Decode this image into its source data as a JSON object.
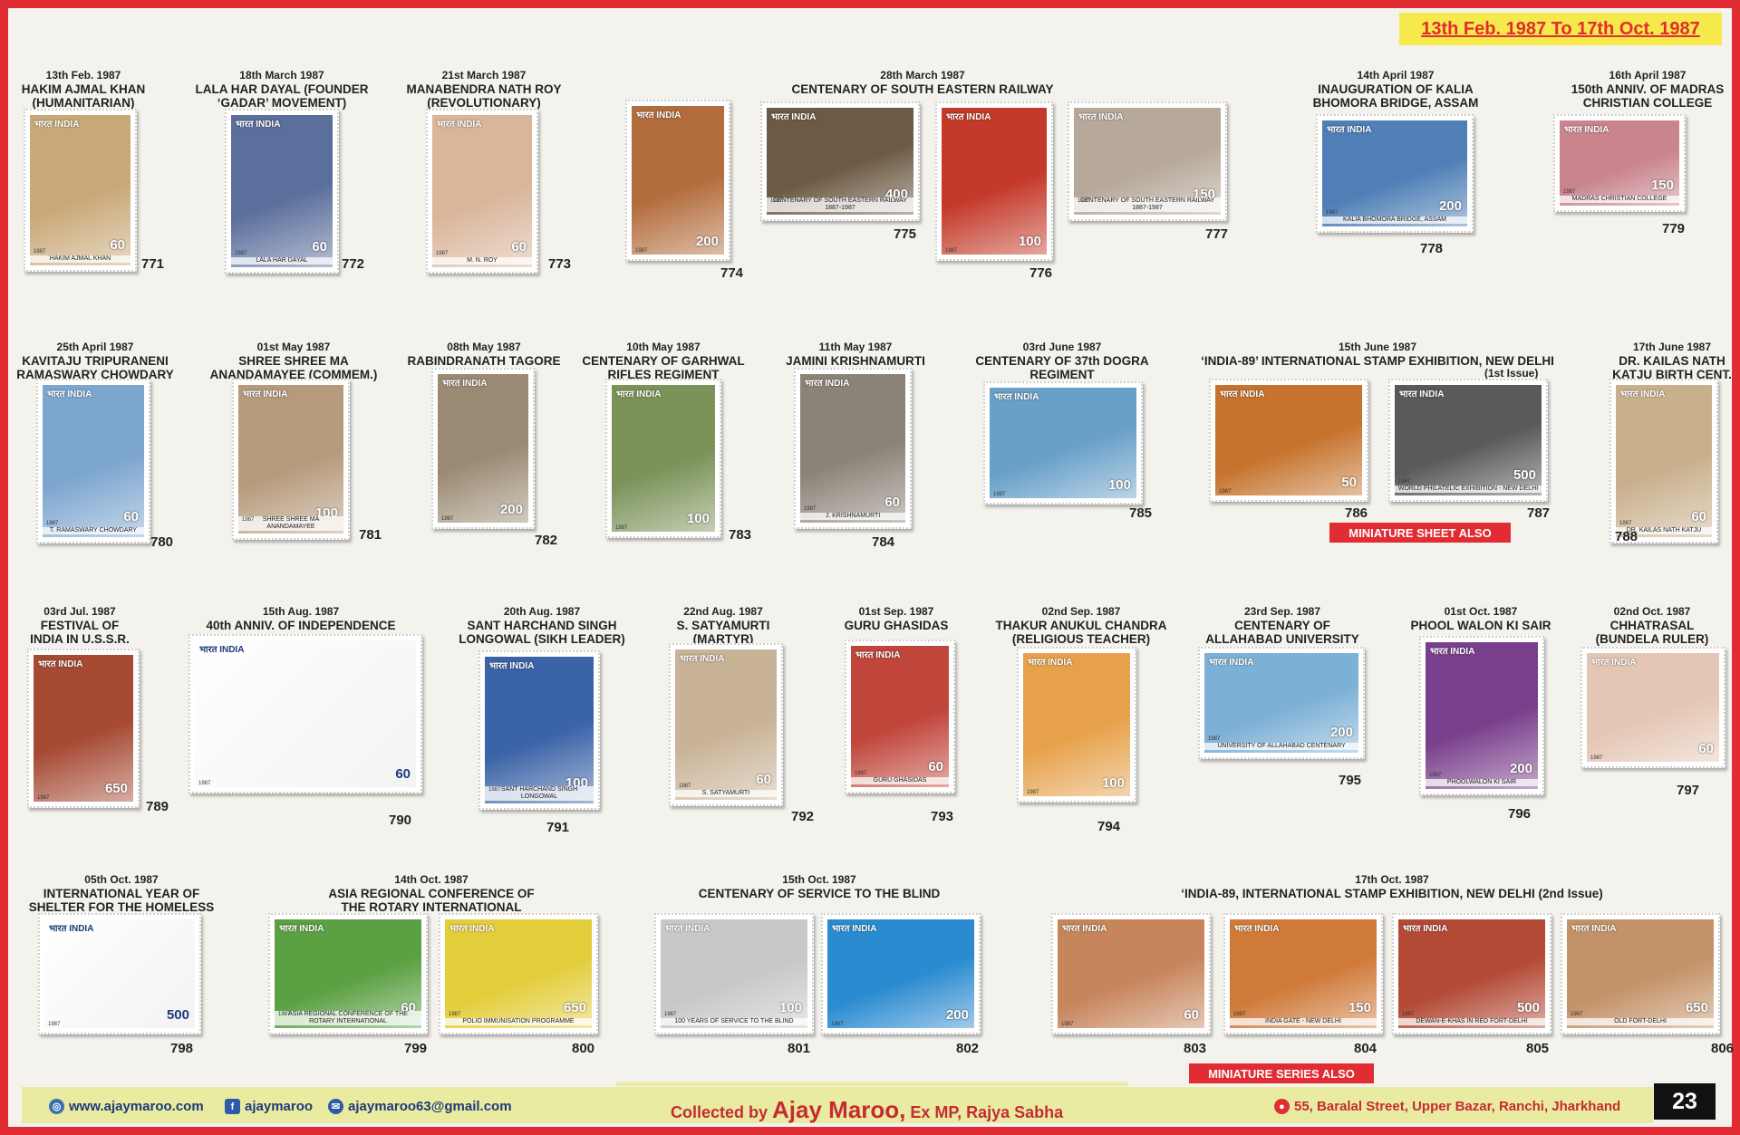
{
  "date_range": "13th Feb. 1987 To 17th Oct. 1987",
  "groups": [
    {
      "date": "13th Feb. 1987",
      "title": [
        "HAKIM AJMAL KHAN",
        "(HUMANITARIAN)"
      ]
    },
    {
      "date": "18th March 1987",
      "title": [
        "LALA HAR DAYAL (FOUNDER",
        "‘GADAR’ MOVEMENT)"
      ]
    },
    {
      "date": "21st March 1987",
      "title": [
        "MANABENDRA NATH ROY",
        "(REVOLUTIONARY)"
      ]
    },
    {
      "date": "28th March 1987",
      "title": [
        "CENTENARY OF SOUTH EASTERN RAILWAY"
      ]
    },
    {
      "date": "14th April 1987",
      "title": [
        "INAUGURATION OF KALIA",
        "BHOMORA BRIDGE, ASSAM"
      ]
    },
    {
      "date": "16th April 1987",
      "title": [
        "150th ANNIV. OF MADRAS",
        "CHRISTIAN COLLEGE"
      ]
    },
    {
      "date": "25th April 1987",
      "title": [
        "KAVITAJU TRIPURANENI",
        "RAMASWARY CHOWDARY"
      ]
    },
    {
      "date": "01st May 1987",
      "title": [
        "SHREE SHREE MA",
        "ANANDAMAYEE (COMMEM.)"
      ]
    },
    {
      "date": "08th May 1987",
      "title": [
        "RABINDRANATH TAGORE"
      ]
    },
    {
      "date": "10th May 1987",
      "title": [
        "CENTENARY OF GARHWAL",
        "RIFLES REGIMENT"
      ]
    },
    {
      "date": "11th May 1987",
      "title": [
        "JAMINI KRISHNAMURTI"
      ]
    },
    {
      "date": "03rd June 1987",
      "title": [
        "CENTENARY OF 37th DOGRA",
        "REGIMENT"
      ]
    },
    {
      "date": "15th  June 1987",
      "title": [
        "‘INDIA-89’ INTERNATIONAL STAMP EXHIBITION, NEW DELHI"
      ]
    },
    {
      "date": "17th  June 1987",
      "title": [
        "DR. KAILAS NATH",
        "KATJU BIRTH CENT."
      ]
    },
    {
      "date": "03rd Jul. 1987",
      "title": [
        "FESTIVAL OF",
        "INDIA IN U.S.S.R."
      ]
    },
    {
      "date": "15th Aug. 1987",
      "title": [
        "40th ANNIV. OF INDEPENDENCE"
      ]
    },
    {
      "date": "20th Aug. 1987",
      "title": [
        "SANT HARCHAND SINGH",
        "LONGOWAL (SIKH LEADER)"
      ]
    },
    {
      "date": "22nd Aug. 1987",
      "title": [
        "S. SATYAMURTI",
        "(MARTYR)"
      ]
    },
    {
      "date": "01st Sep. 1987",
      "title": [
        "GURU GHASIDAS"
      ]
    },
    {
      "date": "02nd Sep. 1987",
      "title": [
        "THAKUR ANUKUL CHANDRA",
        "(RELIGIOUS TEACHER)"
      ]
    },
    {
      "date": "23rd Sep. 1987",
      "title": [
        "CENTENARY OF",
        "ALLAHABAD UNIVERSITY"
      ]
    },
    {
      "date": "01st Oct. 1987",
      "title": [
        "PHOOL WALON KI SAIR"
      ]
    },
    {
      "date": "02nd Oct. 1987",
      "title": [
        "CHHATRASAL",
        "(BUNDELA RULER)"
      ]
    },
    {
      "date": "05th Oct. 1987",
      "title": [
        "INTERNATIONAL YEAR OF",
        "SHELTER FOR THE HOMELESS"
      ]
    },
    {
      "date": "14th Oct. 1987",
      "title": [
        "ASIA REGIONAL CONFERENCE OF",
        "THE ROTARY INTERNATIONAL"
      ]
    },
    {
      "date": "15th Oct. 1987",
      "title": [
        "CENTENARY OF SERVICE TO THE BLIND"
      ]
    },
    {
      "date": "17th Oct. 1987",
      "title": [
        "‘INDIA-89, INTERNATIONAL STAMP EXHIBITION, NEW DELHI (2nd Issue)"
      ]
    }
  ],
  "first_issue_note": "(1st Issue)",
  "stamps": [
    {
      "num": "771",
      "value": "60",
      "caption": "HAKIM AJMAL KHAN",
      "bg": "#c9a878"
    },
    {
      "num": "772",
      "value": "60",
      "caption": "LALA HAR DAYAL",
      "bg": "#5b6f9c"
    },
    {
      "num": "773",
      "value": "60",
      "caption": "M. N. ROY",
      "bg": "#d9b59a"
    },
    {
      "num": "774",
      "value": "200",
      "caption": "",
      "bg": "#b36c3c"
    },
    {
      "num": "775",
      "value": "400",
      "caption": "CENTENARY OF SOUTH EASTERN RAILWAY 1887-1987",
      "bg": "#6d5a44"
    },
    {
      "num": "776",
      "value": "100",
      "caption": "",
      "bg": "#c43a2a"
    },
    {
      "num": "777",
      "value": "150",
      "caption": "CENTENARY OF SOUTH EASTERN RAILWAY 1887-1987",
      "bg": "#b6a89a"
    },
    {
      "num": "778",
      "value": "200",
      "caption": "KALIA BHOMORA BRIDGE, ASSAM",
      "bg": "#4f7fb6"
    },
    {
      "num": "779",
      "value": "150",
      "caption": "MADRAS CHRISTIAN COLLEGE",
      "bg": "#c9848d"
    },
    {
      "num": "780",
      "value": "60",
      "caption": "T. RAMASWARY CHOWDARY",
      "bg": "#7da6cf"
    },
    {
      "num": "781",
      "value": "100",
      "caption": "SHREE SHREE MA ANANDAMAYEE",
      "bg": "#b69a7c"
    },
    {
      "num": "782",
      "value": "200",
      "caption": "",
      "bg": "#9b8a73"
    },
    {
      "num": "783",
      "value": "100",
      "caption": "",
      "bg": "#7b9258"
    },
    {
      "num": "784",
      "value": "60",
      "caption": "J. KRISHNAMURTI",
      "bg": "#8c8378"
    },
    {
      "num": "785",
      "value": "100",
      "caption": "",
      "bg": "#69a0c9"
    },
    {
      "num": "786",
      "value": "50",
      "caption": "",
      "bg": "#c6732d"
    },
    {
      "num": "787",
      "value": "500",
      "caption": "WORLD PHILATELIC EXHIBITION - NEW DELHI",
      "bg": "#5a5a5a"
    },
    {
      "num": "788",
      "value": "60",
      "caption": "DR. KAILAS NATH KATJU",
      "bg": "#c9b08d"
    },
    {
      "num": "789",
      "value": "650",
      "caption": "",
      "bg": "#a64a34"
    },
    {
      "num": "790",
      "value": "60",
      "caption": "",
      "bg": "#ffffff"
    },
    {
      "num": "791",
      "value": "100",
      "caption": "SANT HARCHAND SINGH LONGOWAL",
      "bg": "#3b63a7"
    },
    {
      "num": "792",
      "value": "60",
      "caption": "S. SATYAMURTI",
      "bg": "#c9b397"
    },
    {
      "num": "793",
      "value": "60",
      "caption": "GURU GHASIDAS",
      "bg": "#c0463b"
    },
    {
      "num": "794",
      "value": "100",
      "caption": "",
      "bg": "#e6a14a"
    },
    {
      "num": "795",
      "value": "200",
      "caption": "UNIVERSITY OF ALLAHABAD CENTENARY",
      "bg": "#7db0d6"
    },
    {
      "num": "796",
      "value": "200",
      "caption": "PHOOLWALON KI SAIR",
      "bg": "#7a3f8c"
    },
    {
      "num": "797",
      "value": "60",
      "caption": "",
      "bg": "#e4c6b4"
    },
    {
      "num": "798",
      "value": "500",
      "caption": "",
      "bg": "#ffffff"
    },
    {
      "num": "799",
      "value": "60",
      "caption": "ASIA REGIONAL CONFERENCE OF THE ROTARY INTERNATIONAL",
      "bg": "#5ba043"
    },
    {
      "num": "800",
      "value": "650",
      "caption": "POLIO IMMUNISATION PROGRAMME",
      "bg": "#e3cd3a"
    },
    {
      "num": "801",
      "value": "100",
      "caption": "100 YEARS OF SERVICE TO THE BLIND",
      "bg": "#c8c8c8"
    },
    {
      "num": "802",
      "value": "200",
      "caption": "",
      "bg": "#2b8bd0"
    },
    {
      "num": "803",
      "value": "60",
      "caption": "",
      "bg": "#c7855c"
    },
    {
      "num": "804",
      "value": "150",
      "caption": "INDIA GATE - NEW DELHI",
      "bg": "#d07a3a"
    },
    {
      "num": "805",
      "value": "500",
      "caption": "DEWAN-E-KHAS IN RED FORT-DELHI",
      "bg": "#b34a36"
    },
    {
      "num": "806",
      "value": "650",
      "caption": "OLD FORT-DELHI",
      "bg": "#c49268"
    }
  ],
  "country_label": "भारत INDIA",
  "year_label": "1987",
  "badges": {
    "miniature_sheet": "MINIATURE SHEET ALSO",
    "miniature_series": "MINIATURE SERIES ALSO"
  },
  "footer": {
    "website": "www.ajaymaroo.com",
    "facebook": "ajaymaroo",
    "email": "ajaymaroo63@gmail.com",
    "collected_prefix": "Collected by ",
    "collector": "Ajay Maroo,",
    "collector_suffix": " Ex MP, Rajya Sabha",
    "address": "55, Baralal Street, Upper Bazar, Ranchi, Jharkhand",
    "page_number": "23"
  },
  "colors": {
    "border": "#e22c33",
    "background": "#f4f2ec",
    "accent_yellow": "#f5e94b",
    "footer_band": "#e9eba0",
    "footer_text": "#1e3a78"
  }
}
